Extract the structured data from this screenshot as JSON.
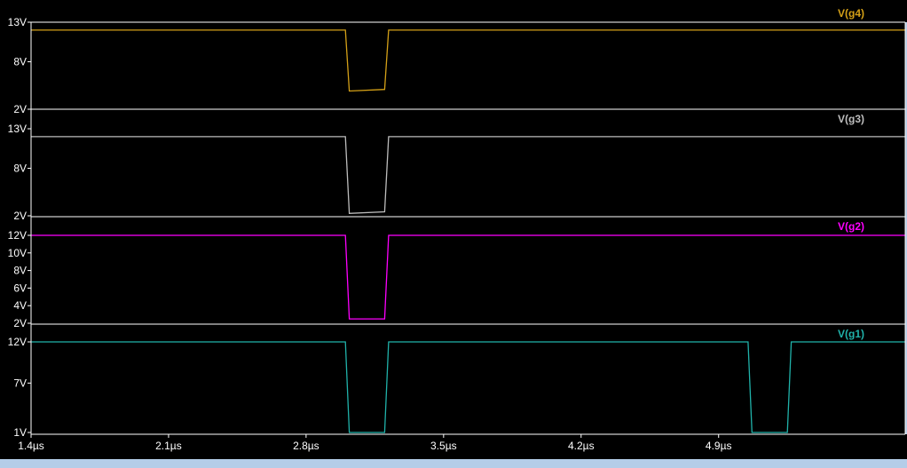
{
  "chart_data": [
    {
      "type": "line",
      "series": [
        {
          "name": "V(g4)",
          "color": "#d4a017",
          "x": [
            1.4,
            3.0,
            3.02,
            3.2,
            3.22,
            5.85
          ],
          "y": [
            12,
            12,
            4.3,
            4.5,
            12,
            12
          ]
        }
      ],
      "ylim": [
        2,
        13
      ],
      "yticks": [
        {
          "v": 13,
          "label": "13V"
        },
        {
          "v": 8,
          "label": "8V"
        },
        {
          "v": 2,
          "label": "2V"
        }
      ],
      "grid": false
    },
    {
      "type": "line",
      "series": [
        {
          "name": "V(g3)",
          "color": "#bdbdbd",
          "x": [
            1.4,
            3.0,
            3.02,
            3.2,
            3.22,
            5.85
          ],
          "y": [
            12,
            12,
            2.3,
            2.5,
            12,
            12
          ]
        }
      ],
      "ylim": [
        2,
        13
      ],
      "yticks": [
        {
          "v": 13,
          "label": "13V"
        },
        {
          "v": 8,
          "label": "8V"
        },
        {
          "v": 2,
          "label": "2V"
        }
      ],
      "grid": false
    },
    {
      "type": "line",
      "series": [
        {
          "name": "V(g2)",
          "color": "#ff00ff",
          "x": [
            1.4,
            3.0,
            3.02,
            3.2,
            3.22,
            5.85
          ],
          "y": [
            12,
            12,
            2.5,
            2.5,
            12,
            12
          ]
        }
      ],
      "ylim": [
        2,
        12
      ],
      "yticks": [
        {
          "v": 12,
          "label": "12V"
        },
        {
          "v": 10,
          "label": "10V"
        },
        {
          "v": 8,
          "label": "8V"
        },
        {
          "v": 6,
          "label": "6V"
        },
        {
          "v": 4,
          "label": "4V"
        },
        {
          "v": 2,
          "label": "2V"
        }
      ],
      "grid": false
    },
    {
      "type": "line",
      "series": [
        {
          "name": "V(g1)",
          "color": "#20b2aa",
          "x": [
            1.4,
            3.0,
            3.02,
            3.2,
            3.22,
            5.05,
            5.07,
            5.25,
            5.27,
            5.85
          ],
          "y": [
            12,
            12,
            1,
            1,
            12,
            12,
            1,
            1,
            12,
            12
          ]
        }
      ],
      "ylim": [
        1,
        12
      ],
      "yticks": [
        {
          "v": 12,
          "label": "12V"
        },
        {
          "v": 7,
          "label": "7V"
        },
        {
          "v": 1,
          "label": "1V"
        }
      ],
      "xlim": [
        1.4,
        5.85
      ],
      "xticks": [
        {
          "v": 1.4,
          "label": "1.4µs"
        },
        {
          "v": 2.1,
          "label": "2.1µs"
        },
        {
          "v": 2.8,
          "label": "2.8µs"
        },
        {
          "v": 3.5,
          "label": "3.5µs"
        },
        {
          "v": 4.2,
          "label": "4.2µs"
        },
        {
          "v": 4.9,
          "label": "4.9µs"
        }
      ],
      "grid": false
    }
  ]
}
